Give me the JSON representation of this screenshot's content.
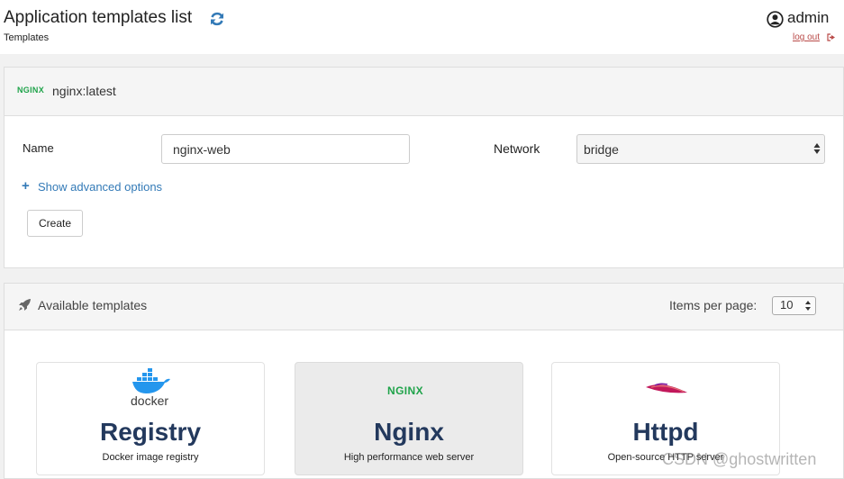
{
  "header": {
    "title": "Application templates list",
    "subtitle": "Templates",
    "username": "admin",
    "logout_label": "log out"
  },
  "form_panel": {
    "template_name": "nginx:latest",
    "template_logo_text": "NGINX",
    "name_label": "Name",
    "name_value": "nginx-web",
    "network_label": "Network",
    "network_value": "bridge",
    "advanced_label": "Show advanced options",
    "create_label": "Create"
  },
  "templates_panel": {
    "title": "Available templates",
    "items_per_page_label": "Items per page:",
    "items_per_page_value": "10",
    "cards": [
      {
        "title": "Registry",
        "description": "Docker image registry",
        "logo_text": "docker",
        "logo": "docker-logo-icon"
      },
      {
        "title": "Nginx",
        "description": "High performance web server",
        "logo_text": "NGINX",
        "logo": "nginx-logo-icon",
        "selected": true
      },
      {
        "title": "Httpd",
        "description": "Open-source HTTP server",
        "logo": "apache-feather-icon"
      }
    ]
  },
  "watermark": "CSDN @ghostwritten",
  "colors": {
    "accent": "#337ab7",
    "logout": "#b94a48",
    "card_title": "#23395d",
    "nginx_green": "#1fa34a"
  }
}
